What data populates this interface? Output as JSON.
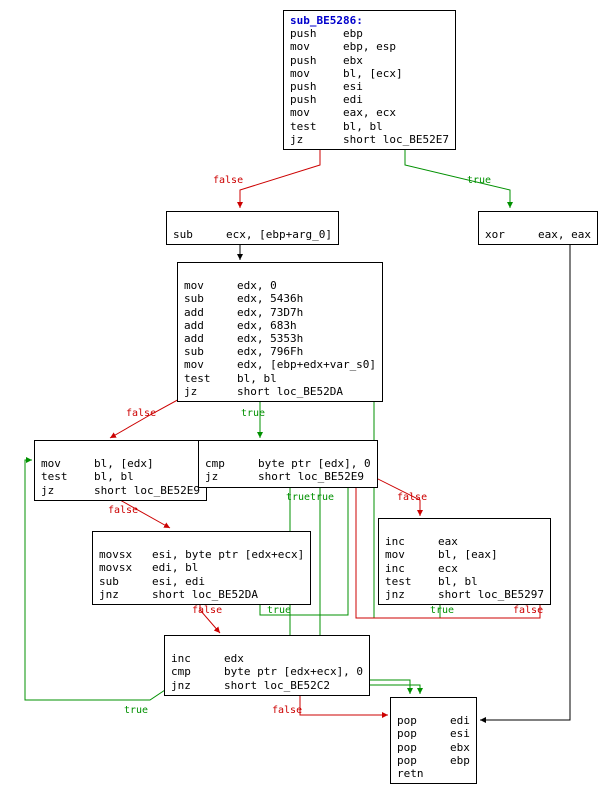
{
  "nodes": {
    "n0": {
      "fn_name": "sub_BE5286:",
      "lines": "push    ebp\nmov     ebp, esp\npush    ebx\nmov     bl, [ecx]\npush    esi\npush    edi\nmov     eax, ecx\ntest    bl, bl\njz      short loc_BE52E7"
    },
    "n1": {
      "lines": "sub     ecx, [ebp+arg_0]"
    },
    "n2": {
      "lines": "xor     eax, eax"
    },
    "n3": {
      "lines": "mov     edx, 0\nsub     edx, 5436h\nadd     edx, 73D7h\nadd     edx, 683h\nadd     edx, 5353h\nsub     edx, 796Fh\nmov     edx, [ebp+edx+var_s0]\ntest    bl, bl\njz      short loc_BE52DA"
    },
    "n4": {
      "lines": "mov     bl, [edx]\ntest    bl, bl\njz      short loc_BE52E9"
    },
    "n5": {
      "lines": "cmp     byte ptr [edx], 0\njz      short loc_BE52E9"
    },
    "n6": {
      "lines": "movsx   esi, byte ptr [edx+ecx]\nmovsx   edi, bl\nsub     esi, edi\njnz     short loc_BE52DA"
    },
    "n7": {
      "lines": "inc     eax\nmov     bl, [eax]\ninc     ecx\ntest    bl, bl\njnz     short loc_BE5297"
    },
    "n8": {
      "lines": "inc     edx\ncmp     byte ptr [edx+ecx], 0\njnz     short loc_BE52C2"
    },
    "n9": {
      "lines": "pop     edi\npop     esi\npop     ebx\npop     ebp\nretn"
    }
  },
  "edge_labels": {
    "e0_1": "false",
    "e0_2": "true",
    "e3_4": "false",
    "e3_5": "true",
    "e4_6": "false",
    "e4_9a": "true",
    "e5_7": "false",
    "e5_9": "true",
    "e6_8": "false",
    "e6_5": "true",
    "e7_3": "true",
    "e7_5b": "false",
    "e8_4": "true",
    "e8_9": "false"
  }
}
